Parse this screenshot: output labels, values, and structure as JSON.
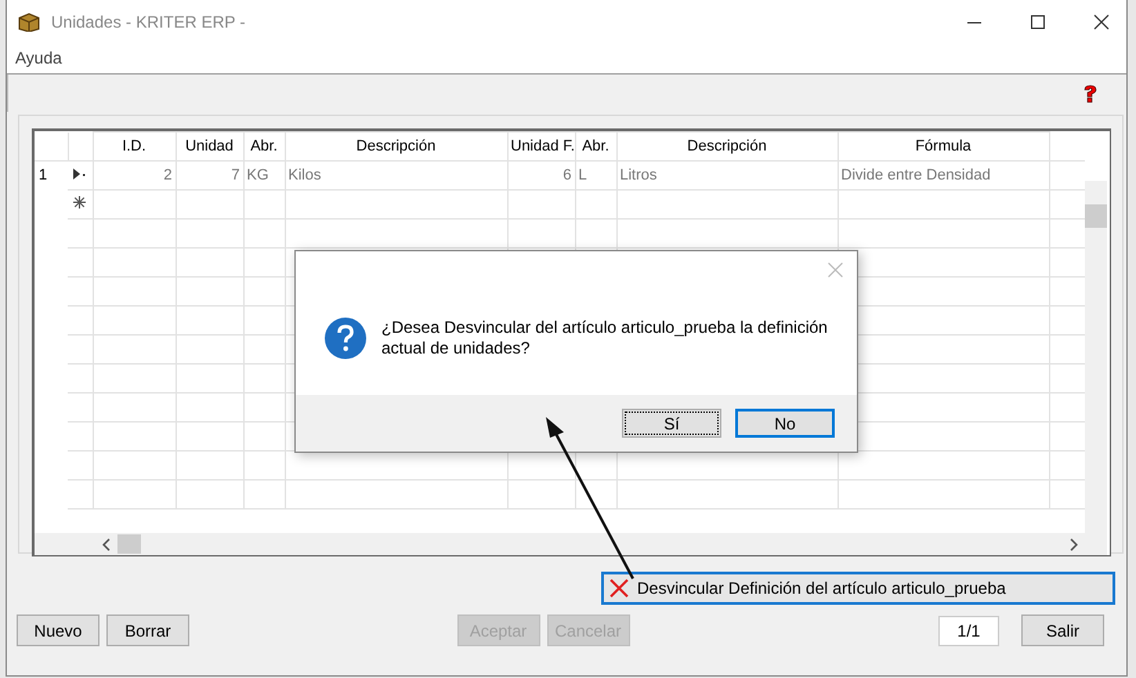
{
  "window": {
    "title": "Unidades - KRITER ERP -"
  },
  "menu": [
    "Ayuda"
  ],
  "grid": {
    "columns": [
      {
        "label": "I.D.",
        "kind": "number"
      },
      {
        "label": "Unidad",
        "kind": "number"
      },
      {
        "label": "Abr.",
        "kind": "text"
      },
      {
        "label": "Descripción",
        "kind": "text"
      },
      {
        "label": "Unidad F.",
        "kind": "number"
      },
      {
        "label": "Abr.",
        "kind": "text"
      },
      {
        "label": "Descripción",
        "kind": "text"
      },
      {
        "label": "Fórmula",
        "kind": "text"
      }
    ],
    "rows": [
      {
        "number": "1",
        "current": true,
        "cells": [
          "2",
          "7",
          "KG",
          "Kilos",
          "6",
          "L",
          "Litros",
          "Divide entre Densidad"
        ]
      }
    ],
    "new_row": true
  },
  "status": {
    "text": "Desvincular Definición del artículo articulo_prueba",
    "error": true
  },
  "buttons_left": [
    {
      "label": "Nuevo",
      "disabled": false
    },
    {
      "label": "Borrar",
      "disabled": false
    }
  ],
  "buttons_center": [
    {
      "label": "Aceptar",
      "disabled": true
    },
    {
      "label": "Cancelar",
      "disabled": true
    }
  ],
  "pager": "1/1",
  "exit_button": {
    "label": "Salir",
    "disabled": false
  },
  "dialog": {
    "message": "¿Desea Desvincular del artículo articulo_prueba la definición actual de unidades?",
    "buttons": [
      {
        "label": "Sí",
        "focused": true,
        "default": false
      },
      {
        "label": "No",
        "focused": false,
        "default": true
      }
    ]
  }
}
